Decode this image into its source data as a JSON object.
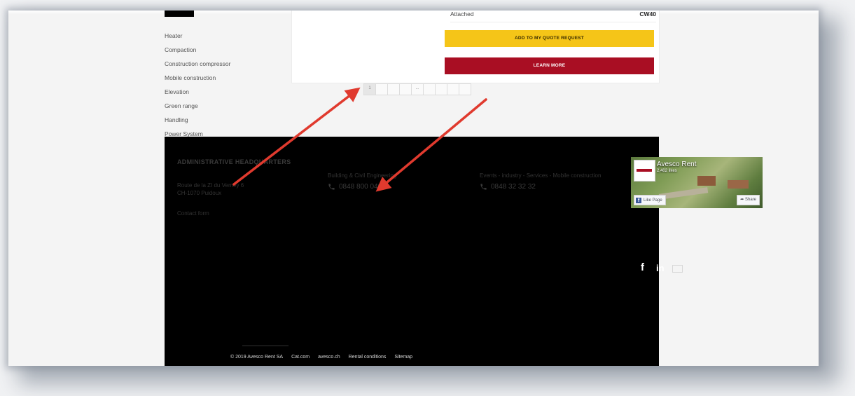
{
  "sidebar": {
    "items": [
      "Heater",
      "Compaction",
      "Construction compressor",
      "Mobile construction",
      "Elevation",
      "Green range",
      "Handling",
      "Power System"
    ]
  },
  "product": {
    "attached_label": "Attached",
    "attached_value": "CW40",
    "quote_button": "ADD TO MY QUOTE REQUEST",
    "learn_button": "LEARN MORE"
  },
  "pagination": {
    "pages": [
      "1",
      "",
      "",
      "",
      "...",
      "",
      "",
      "",
      ""
    ]
  },
  "footer": {
    "hq_title": "ADMINISTRATIVE HEADQUARTERS",
    "address_line1": "Route de la ZI du Verney 6",
    "address_line2": "CH-1070 Puidoux",
    "contact_form": "Contact form",
    "contact1_label": "Building & Civil Engineering",
    "contact1_phone": "0848 800 040",
    "contact2_label": "Events - industry - Services - Mobile construction",
    "contact2_phone": "0848 32 32 32",
    "copyright": "© 2019 Avesco Rent SA",
    "links": [
      "Cat.com",
      "avesco.ch",
      "Rental conditions",
      "Sitemap"
    ]
  },
  "facebook_widget": {
    "name": "Avesco Rent",
    "likes": "2,402 likes",
    "like_button": "Like Page",
    "share_button": "Share"
  },
  "social": {
    "icons": [
      "facebook-icon",
      "linkedin-icon",
      "mail-icon"
    ]
  },
  "colors": {
    "quote_button": "#f5c518",
    "learn_button": "#a90e23",
    "footer_bg": "#000000",
    "annotation_arrow": "#e03a2e"
  }
}
